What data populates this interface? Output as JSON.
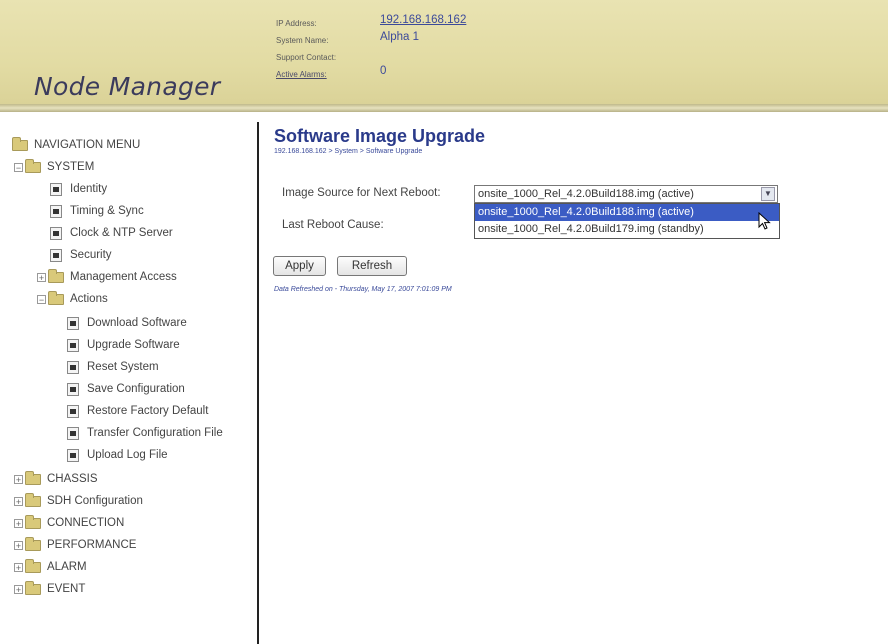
{
  "header": {
    "logo": "Node Manager",
    "info": [
      {
        "label": "IP Address:",
        "value": "192.168.168.162",
        "link": true
      },
      {
        "label": "System Name:",
        "value": "Alpha 1",
        "link": false
      },
      {
        "label": "Support Contact:",
        "value": "",
        "link": false
      },
      {
        "label": "Active Alarms:",
        "value": "0",
        "link": false
      }
    ]
  },
  "nav": {
    "header": "NAVIGATION MENU",
    "system": "SYSTEM",
    "identity": "Identity",
    "timing": "Timing & Sync",
    "clock": "Clock & NTP Server",
    "security": "Security",
    "management": "Management Access",
    "actions": "Actions",
    "download": "Download Software",
    "upgrade": "Upgrade Software",
    "reset": "Reset System",
    "save": "Save Configuration",
    "restore": "Restore Factory Default",
    "transfer": "Transfer Configuration File",
    "upload": "Upload Log File",
    "chassis": "CHASSIS",
    "sdh": "SDH Configuration",
    "connection": "CONNECTION",
    "performance": "PERFORMANCE",
    "alarm": "ALARM",
    "event": "EVENT"
  },
  "main": {
    "title": "Software Image Upgrade",
    "breadcrumb": "192.168.168.162 > System > Software Upgrade",
    "image_source_label": "Image Source for Next Reboot:",
    "selected_value": "onsite_1000_Rel_4.2.0Build188.img (active)",
    "options": [
      "onsite_1000_Rel_4.2.0Build188.img (active)",
      "onsite_1000_Rel_4.2.0Build179.img (standby)"
    ],
    "last_reboot_label": "Last Reboot Cause:",
    "apply": "Apply",
    "refresh": "Refresh",
    "refreshed": "Data Refreshed on - Thursday, May 17, 2007 7:01:09 PM"
  }
}
